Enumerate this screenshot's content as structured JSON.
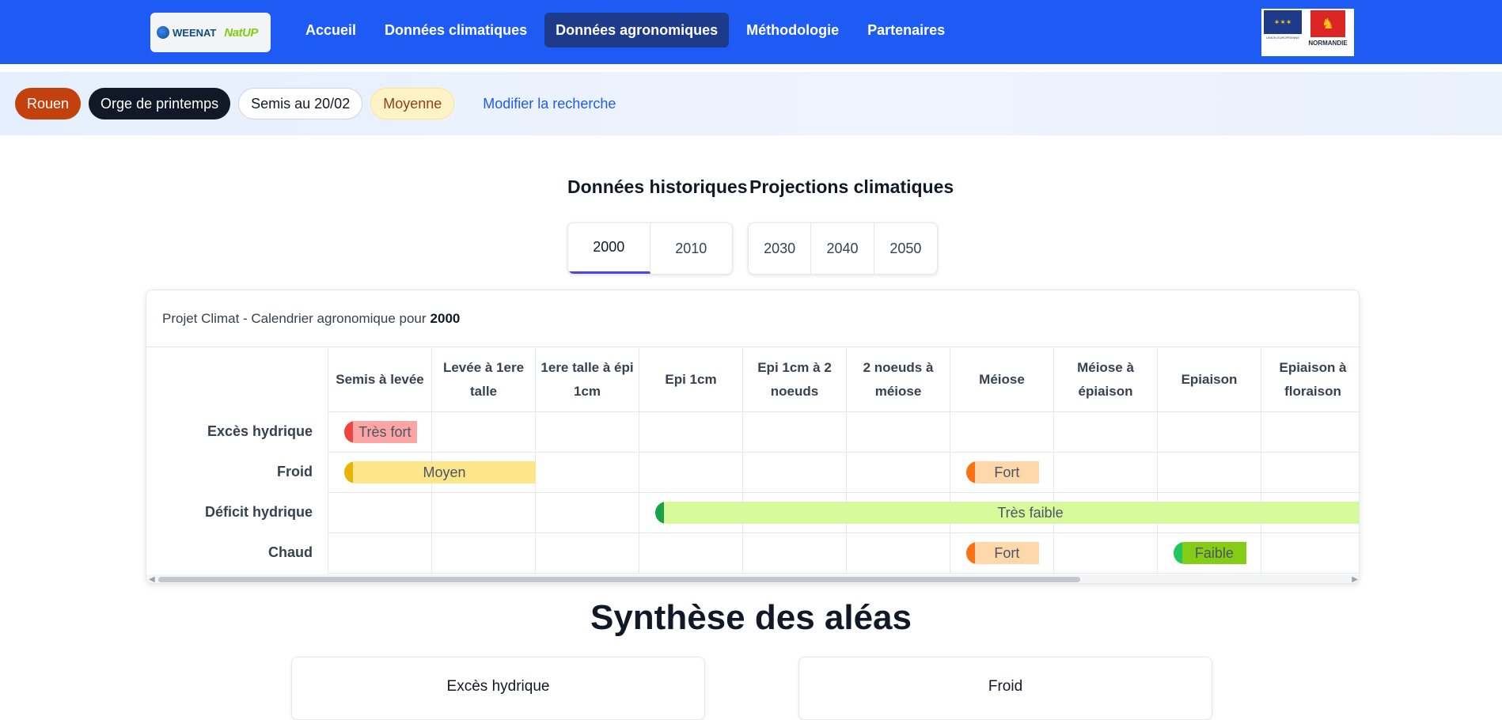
{
  "header": {
    "logo_weenat": "WEENAT",
    "logo_natup": "NatUP",
    "nav": [
      {
        "label": "Accueil",
        "active": false
      },
      {
        "label": "Données climatiques",
        "active": false
      },
      {
        "label": "Données agronomiques",
        "active": true
      },
      {
        "label": "Méthodologie",
        "active": false
      },
      {
        "label": "Partenaires",
        "active": false
      }
    ],
    "partner_logo_text": "NORMANDIE",
    "eu_text": "UNION EUROPÉENNE"
  },
  "filters": {
    "city": "Rouen",
    "crop": "Orge de printemps",
    "sowing": "Semis au 20/02",
    "scenario": "Moyenne",
    "modify_label": "Modifier la recherche"
  },
  "periods": {
    "historical_title": "Données historiques",
    "projection_title": "Projections climatiques",
    "historical": [
      "2000",
      "2010"
    ],
    "projections": [
      "2030",
      "2040",
      "2050"
    ],
    "selected": "2000"
  },
  "calendar": {
    "title_prefix": "Projet Climat - Calendrier agronomique pour",
    "title_year": "2000",
    "stages": [
      "Semis à levée",
      "Levée à 1ere talle",
      "1ere talle à épi 1cm",
      "Epi 1cm",
      "Epi 1cm à 2 noeuds",
      "2 noeuds à méiose",
      "Méiose",
      "Méiose à épiaison",
      "Epiaison",
      "Epiaison à floraison"
    ],
    "rows": [
      {
        "label": "Excès hydrique",
        "bars": [
          {
            "stage_start": 0,
            "stage_fraction": 0.7,
            "level": "Très fort",
            "fill": "#fca5a5",
            "cap": "#ef4444"
          }
        ]
      },
      {
        "label": "Froid",
        "bars": [
          {
            "stage_start": 0,
            "stage_end": 2,
            "level": "Moyen",
            "fill": "#fde68a",
            "cap": "#eab308"
          },
          {
            "stage_start": 6,
            "stage_fraction": 0.7,
            "level": "Fort",
            "fill": "#fed7aa",
            "cap": "#f97316"
          }
        ]
      },
      {
        "label": "Déficit hydrique",
        "bars": [
          {
            "stage_start": 3,
            "stage_end": 10,
            "level": "Très faible",
            "fill": "#d9f99d",
            "cap": "#16a34a"
          }
        ]
      },
      {
        "label": "Chaud",
        "bars": [
          {
            "stage_start": 6,
            "stage_fraction": 0.7,
            "level": "Fort",
            "fill": "#fed7aa",
            "cap": "#f97316"
          },
          {
            "stage_start": 8,
            "stage_fraction": 0.7,
            "level": "Faible",
            "fill": "#84cc16",
            "cap": "#22c55e"
          }
        ]
      }
    ]
  },
  "synthesis": {
    "title": "Synthèse des aléas",
    "cards": [
      "Excès hydrique",
      "Froid"
    ]
  }
}
